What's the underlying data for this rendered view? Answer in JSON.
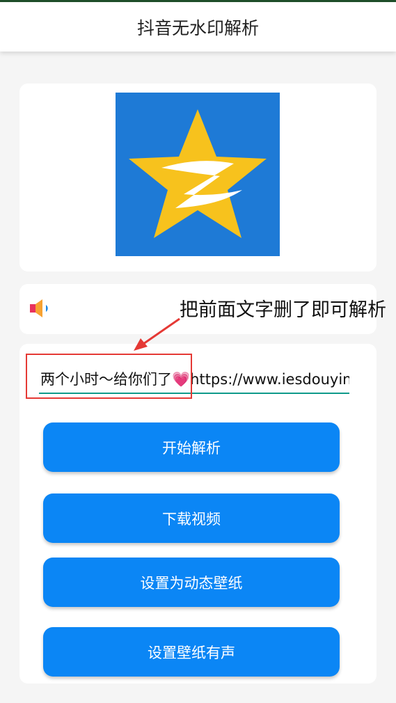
{
  "app": {
    "title": "抖音无水印解析"
  },
  "logo": {
    "icon": "qzone-star-logo",
    "bg_color": "#1e7ad6",
    "star_color": "#f7c21d"
  },
  "audio": {
    "icon": "speaker-icon"
  },
  "input": {
    "visible_text_prefix": "两个小时～给你们了",
    "heart": "💗",
    "visible_text_suffix": "https://www.iesdouyin"
  },
  "buttons": {
    "parse": "开始解析",
    "download": "下载视频",
    "set_wallpaper": "设置为动态壁纸",
    "wallpaper_sound": "设置壁纸有声"
  },
  "annotation": {
    "text": "把前面文字删了即可解析"
  },
  "colors": {
    "accent": "#0b86f5",
    "underline": "#0e9a8a",
    "annotation_red": "#e53935"
  }
}
